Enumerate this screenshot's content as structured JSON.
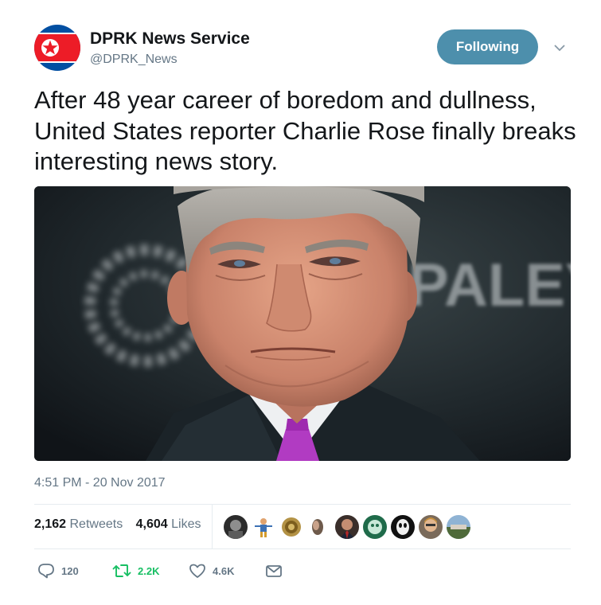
{
  "account": {
    "display_name": "DPRK News Service",
    "handle": "@DPRK_News",
    "follow_label": "Following"
  },
  "tweet": {
    "text": "After 48 year career of boredom and dullness, United States reporter Charlie Rose finally breaks interesting news story.",
    "timestamp": "4:51 PM - 20 Nov 2017"
  },
  "media": {
    "backdrop_text": "PALEY"
  },
  "stats": {
    "retweets_count": "2,162",
    "retweets_label": "Retweets",
    "likes_count": "4,604",
    "likes_label": "Likes"
  },
  "actions": {
    "reply_count": "120",
    "retweet_count": "2.2K",
    "like_count": "4.6K"
  },
  "colors": {
    "follow_button": "#4d8fac",
    "retweet_green": "#17bf63",
    "like_gray": "#657786",
    "text_secondary": "#657786"
  },
  "icons": [
    "chevron-down-icon",
    "reply-icon",
    "retweet-icon",
    "like-icon",
    "direct-message-icon"
  ]
}
